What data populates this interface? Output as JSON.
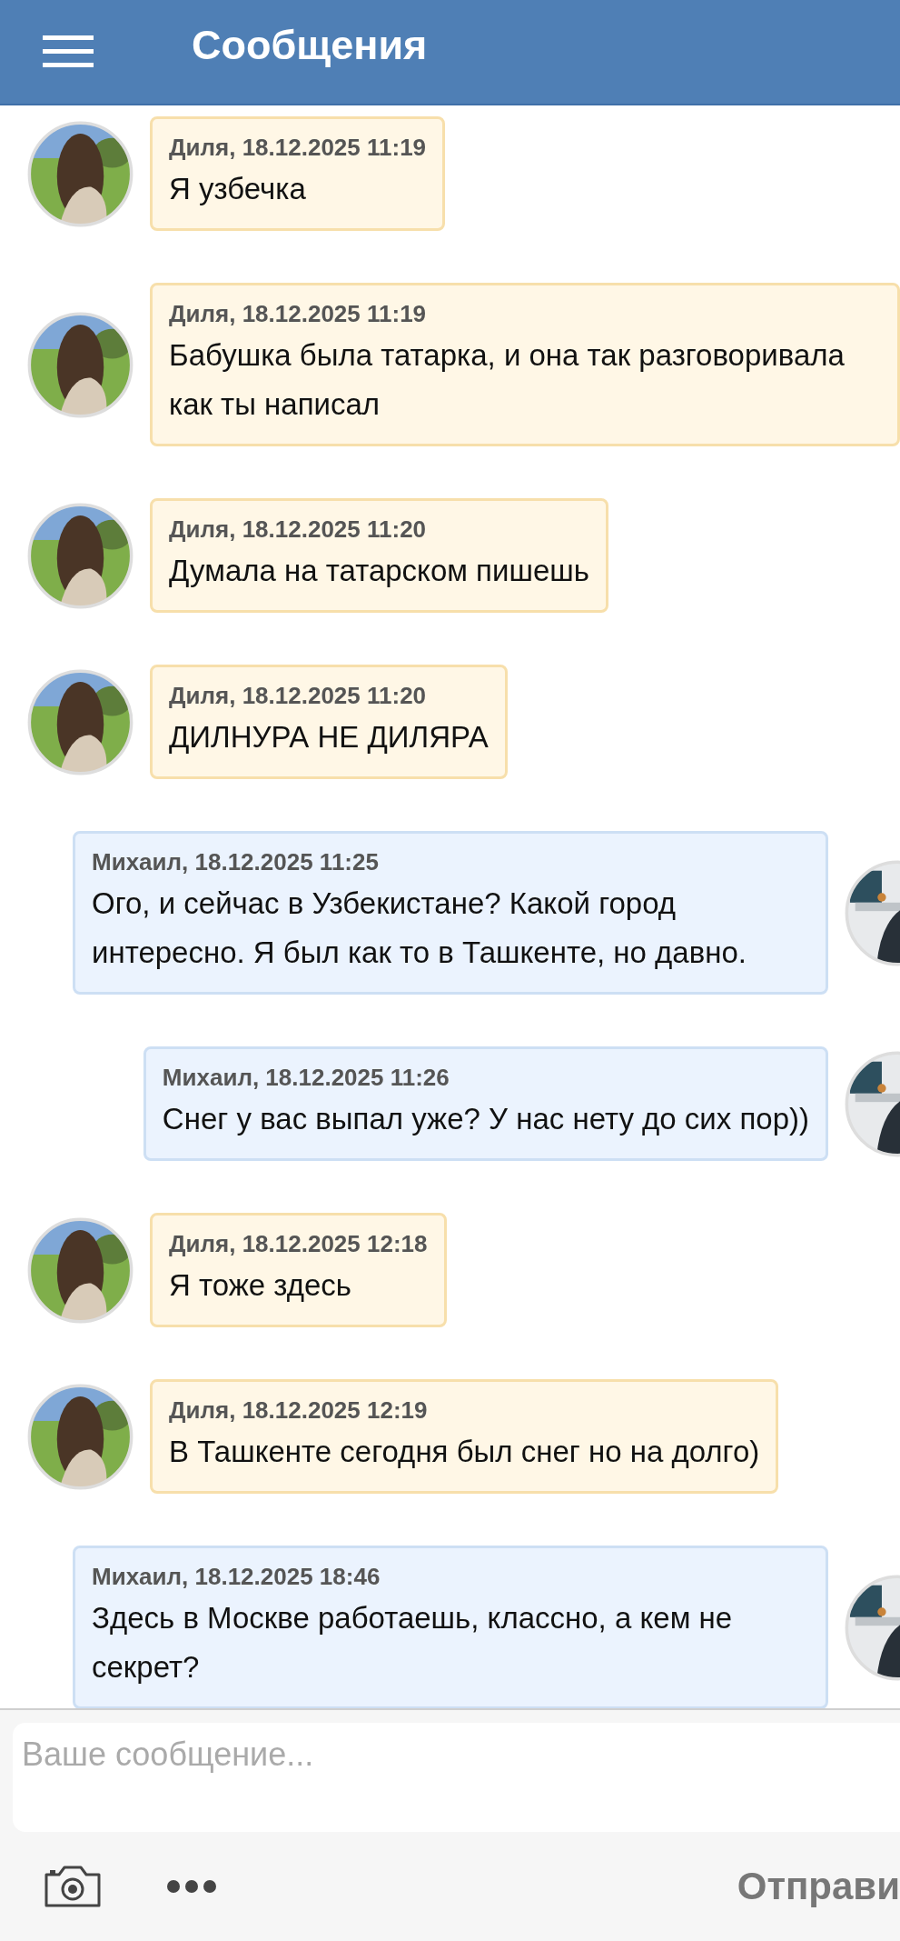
{
  "header": {
    "title": "Сообщения"
  },
  "messages": [
    {
      "kind": "incoming",
      "meta": "Диля, 18.12.2025 11:19",
      "text": "Я узбечка"
    },
    {
      "kind": "incoming",
      "meta": "Диля, 18.12.2025 11:19",
      "text": "Бабушка была татарка, и она так разговоривала как ты написал"
    },
    {
      "kind": "incoming",
      "meta": "Диля, 18.12.2025 11:20",
      "text": "Думала на татарском пишешь"
    },
    {
      "kind": "incoming",
      "meta": "Диля, 18.12.2025 11:20",
      "text": "ДИЛНУРА НЕ ДИЛЯРА"
    },
    {
      "kind": "outgoing",
      "meta": "Михаил, 18.12.2025 11:25",
      "text": "Ого, и сейчас в Узбекистане? Какой город интересно. Я был как то в Ташкенте, но давно."
    },
    {
      "kind": "outgoing",
      "meta": "Михаил, 18.12.2025 11:26",
      "text": "Снег у вас выпал уже? У нас нету до сих пор))"
    },
    {
      "kind": "incoming",
      "meta": "Диля, 18.12.2025 12:18",
      "text": "Я тоже здесь"
    },
    {
      "kind": "incoming",
      "meta": "Диля, 18.12.2025 12:19",
      "text": "В Ташкенте сегодня был снег но на долго)"
    },
    {
      "kind": "outgoing",
      "meta": "Михаил, 18.12.2025 18:46",
      "text": "Здесь в Москве работаешь, классно, а кем не секрет?"
    }
  ],
  "composer": {
    "placeholder": "Ваше сообщение...",
    "send_label": "Отправи"
  }
}
